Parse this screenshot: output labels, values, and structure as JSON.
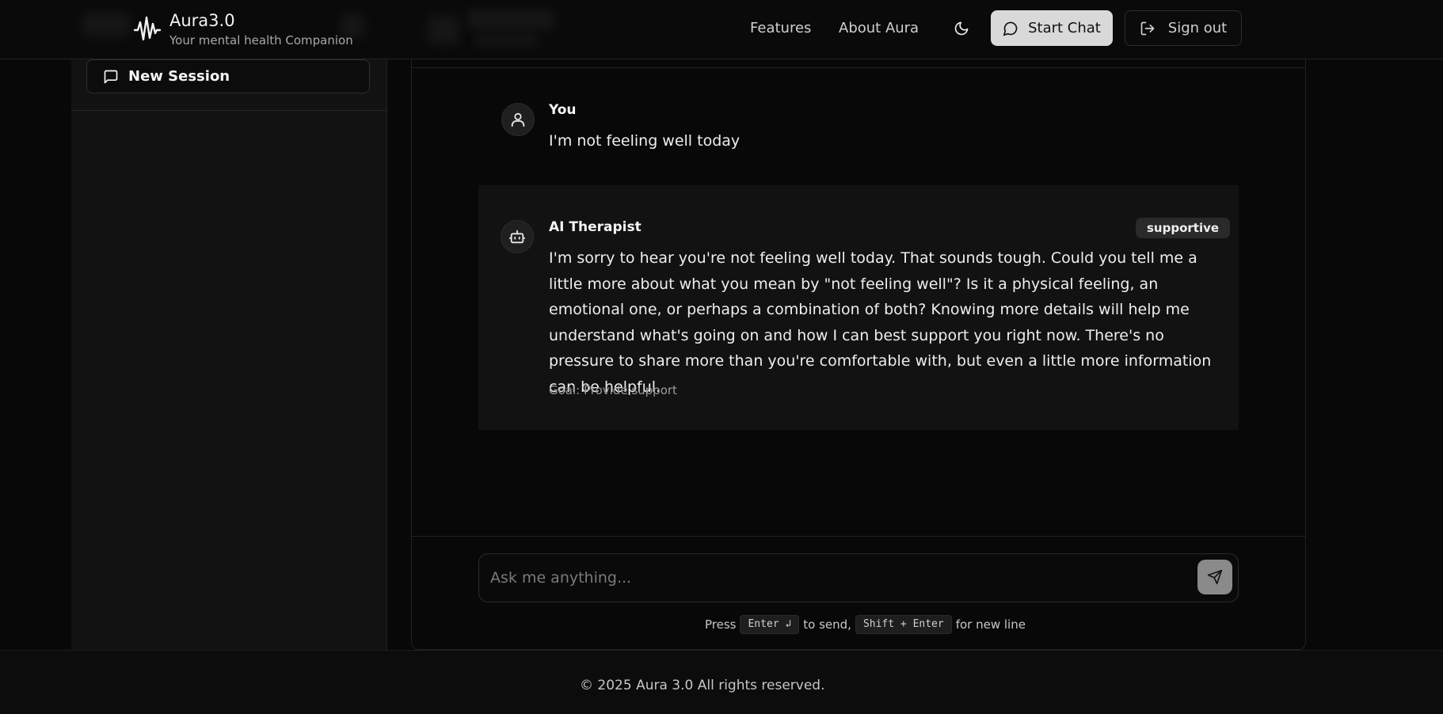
{
  "header": {
    "brand_title": "Aura3.0",
    "brand_subtitle": "Your mental health Companion",
    "nav": [
      "Features",
      "About Aura"
    ],
    "theme_icon": "moon-icon",
    "start_chat_label": "Start Chat",
    "sign_out_label": "Sign out"
  },
  "sidebar": {
    "new_session_label": "New Session"
  },
  "chat": {
    "messages": [
      {
        "sender": "You",
        "icon": "user-icon",
        "text": "I'm not feeling well today"
      },
      {
        "sender": "AI Therapist",
        "icon": "bot-icon",
        "tone": "supportive",
        "text": "I'm sorry to hear you're not feeling well today. That sounds tough. Could you tell me a little more about what you mean by \"not feeling well\"? Is it a physical feeling, an emotional one, or perhaps a combination of both? Knowing more details will help me understand what's going on and how I can best support you right now. There's no pressure to share more than you're comfortable with, but even a little more information can be helpful.",
        "goal": "Goal: Provide support"
      }
    ],
    "input_placeholder": "Ask me anything...",
    "hint": {
      "press": "Press",
      "enter_key": "Enter ↲",
      "to_send": "to send,",
      "shift_enter_key": "Shift + Enter",
      "new_line": "for new line"
    }
  },
  "footer": {
    "copyright": "© 2025 Aura 3.0 All rights reserved."
  },
  "colors": {
    "background": "#080808",
    "panel": "#121212",
    "accent_button": "#d9d9d9"
  }
}
